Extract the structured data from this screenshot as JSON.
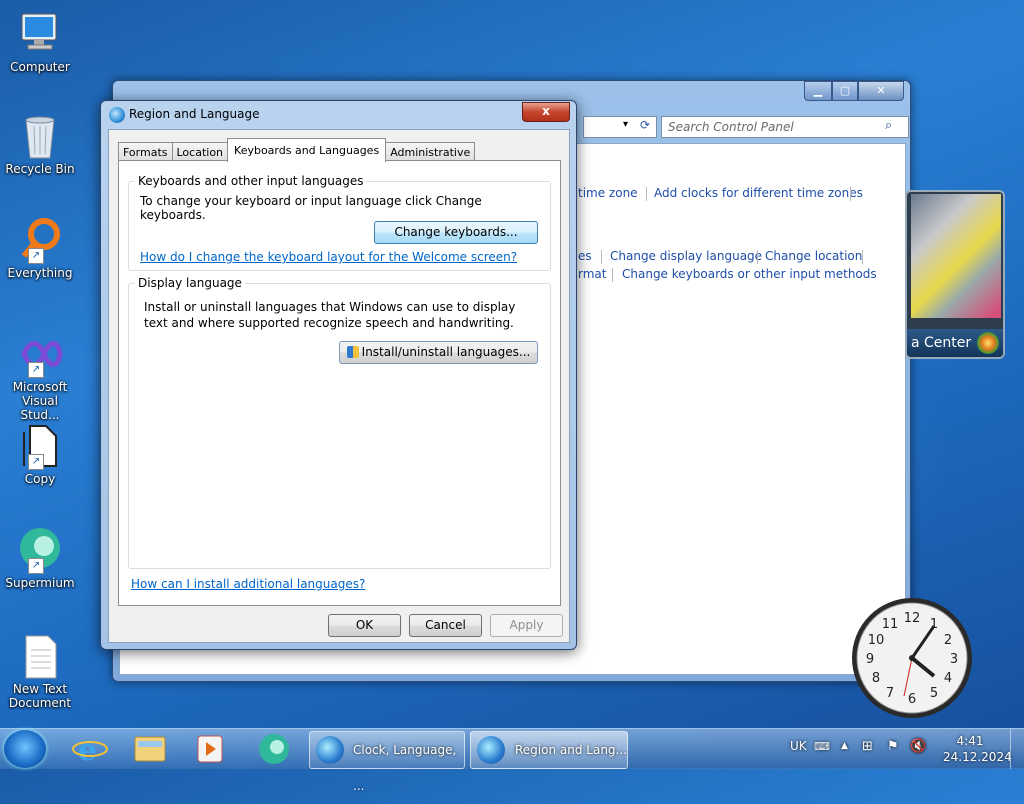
{
  "desktop": {
    "icons": [
      {
        "label": "Computer"
      },
      {
        "label": "Recycle Bin"
      },
      {
        "label": "Everything"
      },
      {
        "label": "Microsoft Visual Stud..."
      },
      {
        "label": "Copy"
      },
      {
        "label": "Supermium"
      },
      {
        "label": "New Text Document"
      }
    ]
  },
  "control_panel": {
    "search_placeholder": "Search Control Panel",
    "links": {
      "time_zone": "time zone",
      "add_clocks": "Add clocks for different time zones",
      "es": "es",
      "change_display_language": "Change display language",
      "change_location": "Change location",
      "rmat": "rmat",
      "change_keyboards_methods": "Change keyboards or other input methods"
    }
  },
  "media_center_gadget": {
    "label": "a Center"
  },
  "dialog": {
    "title": "Region and Language",
    "close_symbol": "x",
    "tabs": [
      "Formats",
      "Location",
      "Keyboards and Languages",
      "Administrative"
    ],
    "active_tab": "Keyboards and Languages",
    "keyboards_group": {
      "title": "Keyboards and other input languages",
      "description": "To change your keyboard or input language click Change keyboards.",
      "button": "Change keyboards...",
      "link": "How do I change the keyboard layout for the Welcome screen?"
    },
    "display_group": {
      "title": "Display language",
      "description": "Install or uninstall languages that Windows can use to display text and where supported recognize speech and handwriting.",
      "button": "Install/uninstall languages..."
    },
    "bottom_link": "How can I install additional languages?",
    "buttons": {
      "ok": "OK",
      "cancel": "Cancel",
      "apply": "Apply"
    }
  },
  "taskbar": {
    "tasks": [
      {
        "label": "Clock, Language, ..."
      },
      {
        "label": "Region and Lang..."
      }
    ],
    "tray": {
      "language": "UK",
      "time": "4:41",
      "date": "24.12.2024"
    }
  }
}
